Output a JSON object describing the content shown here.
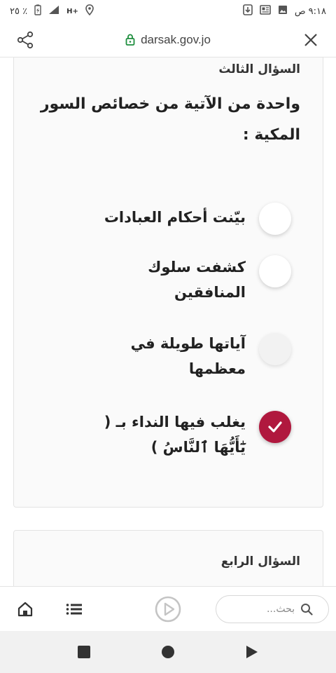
{
  "status_bar": {
    "time": "٩:١٨ ص",
    "battery": "٢٥ ٪",
    "network": "H+"
  },
  "browser": {
    "url": "darsak.gov.jo"
  },
  "question3": {
    "label": "السؤال الثالث",
    "text": "واحدة من الآتية من خصائص السور المكية :",
    "options": [
      {
        "text": "بيّنت أحكام العبادات",
        "state": "unchecked"
      },
      {
        "text": "كشفت سلوك المنافقين",
        "state": "unchecked"
      },
      {
        "text": "آياتها طويلة في معظمها",
        "state": "unchecked"
      },
      {
        "text": "يغلب فيها النداء بـ ( يَٰٓأَيُّهَا ٱلنَّاسُ )",
        "state": "checked"
      }
    ]
  },
  "question4": {
    "label": "السؤال الرابع"
  },
  "bottom_bar": {
    "search_placeholder": "بحث..."
  },
  "colors": {
    "accent": "#b0183e",
    "lock_green": "#1e8e3e"
  }
}
